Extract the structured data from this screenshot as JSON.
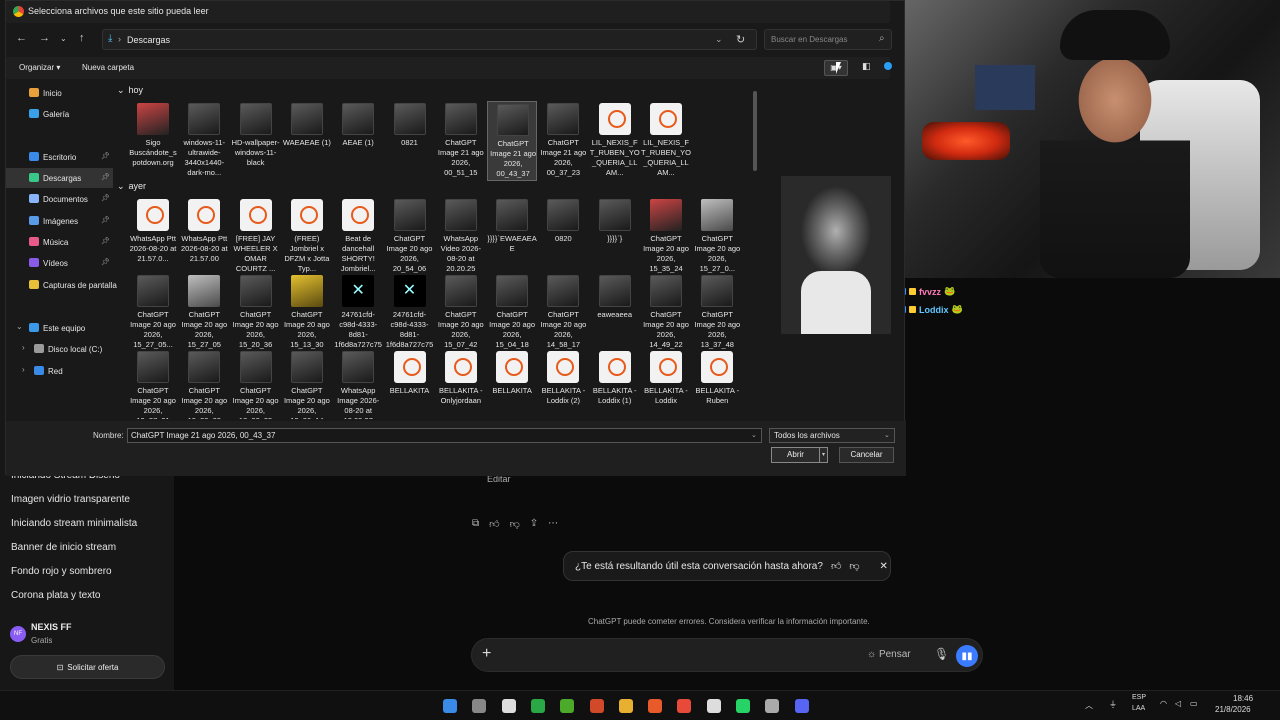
{
  "chat": {
    "history": [
      "Iniciando Stream Diseño",
      "Imagen vidrio transparente",
      "Iniciando stream minimalista",
      "Banner de inicio stream",
      "Fondo rojo y sombrero",
      "Corona plata y texto"
    ],
    "user_initials": "NF",
    "user_name": "NEXIS FF",
    "user_plan": "Gratis",
    "offer_button": "Solicitar oferta",
    "edit_label": "Editar",
    "feedback_question": "¿Te está resultando útil esta conversación hasta ahora?",
    "disclaimer": "ChatGPT puede cometer errores. Considera verificar la información importante.",
    "composer_think": "Pensar"
  },
  "stream_chat": [
    {
      "user": "fvvzz",
      "color": "#ff7ab8"
    },
    {
      "user": "Loddix",
      "color": "#5ec8ff"
    }
  ],
  "dialog": {
    "title": "Selecciona archivos que este sitio pueda leer",
    "path": "Descargas",
    "search_placeholder": "Buscar en Descargas",
    "organize": "Organizar",
    "new_folder": "Nueva carpeta",
    "nav": [
      {
        "label": "Inicio",
        "color": "#e8a03a"
      },
      {
        "label": "Galería",
        "color": "#3aa0e8"
      },
      {
        "label": "Escritorio",
        "color": "#3a8ae8",
        "pinned": true
      },
      {
        "label": "Descargas",
        "color": "#3ac88a",
        "pinned": true,
        "selected": true
      },
      {
        "label": "Documentos",
        "color": "#8ab4f8",
        "pinned": true
      },
      {
        "label": "Imágenes",
        "color": "#5a9be8",
        "pinned": true
      },
      {
        "label": "Música",
        "color": "#e85a8a",
        "pinned": true
      },
      {
        "label": "Vídeos",
        "color": "#8a5ae8",
        "pinned": true
      },
      {
        "label": "Capturas de pantalla",
        "color": "#e8c03a"
      },
      {
        "label": "Este equipo",
        "color": "#3a9ae8"
      },
      {
        "label": "Disco local (C:)",
        "color": "#9a9a9a"
      },
      {
        "label": "Red",
        "color": "#3a8ae8"
      }
    ],
    "groups": [
      "hoy",
      "ayer"
    ],
    "files_today": [
      {
        "name": "Sigo Buscándote_spotdown.org",
        "kind": "red"
      },
      {
        "name": "windows-11-ultrawide-3440x1440-dark-mo...",
        "kind": "img"
      },
      {
        "name": "HD-wallpaper-windows-11-black",
        "kind": "img"
      },
      {
        "name": "WAEAEAE (1)",
        "kind": "img"
      },
      {
        "name": "AEAE (1)",
        "kind": "img"
      },
      {
        "name": "0821",
        "kind": "img"
      },
      {
        "name": "ChatGPT Image 21 ago 2026, 00_51_15",
        "kind": "img"
      },
      {
        "name": "ChatGPT Image 21 ago 2026, 00_43_37",
        "kind": "img",
        "selected": true
      },
      {
        "name": "ChatGPT Image 21 ago 2026, 00_37_23",
        "kind": "img"
      },
      {
        "name": "LIL_NEXIS_FT_RUBEN_YO_QUERIA_LLAM...",
        "kind": "doc"
      },
      {
        "name": "LIL_NEXIS_FT_RUBEN_YO_QUERIA_LLAM...",
        "kind": "doc"
      }
    ],
    "files_yesterday": [
      {
        "name": "WhatsApp Ptt 2026-08-20 at 21.57.0...",
        "kind": "doc"
      },
      {
        "name": "WhatsApp Ptt 2026-08-20 at 21.57.00",
        "kind": "doc"
      },
      {
        "name": "[FREE] JAY WHEELER X OMAR COURTZ ...",
        "kind": "doc"
      },
      {
        "name": "(FREE) Jombriel x DFZM x Jotta Typ...",
        "kind": "doc"
      },
      {
        "name": "Beat de dancehall SHORTY! Jombriel...",
        "kind": "doc"
      },
      {
        "name": "ChatGPT Image 20 ago 2026, 20_54_06",
        "kind": "img"
      },
      {
        "name": "WhatsApp Video 2026-08-20 at 20.20.25",
        "kind": "img"
      },
      {
        "name": "}}}}`EWAEAEAE",
        "kind": "img"
      },
      {
        "name": "0820",
        "kind": "img"
      },
      {
        "name": "}}}}`}",
        "kind": "img"
      },
      {
        "name": "ChatGPT Image 20 ago 2026, 15_35_24",
        "kind": "red"
      },
      {
        "name": "ChatGPT Image 20 ago 2026, 15_27_0...",
        "kind": "img2"
      },
      {
        "name": "ChatGPT Image 20 ago 2026, 15_27_05...",
        "kind": "img"
      },
      {
        "name": "ChatGPT Image 20 ago 2026, 15_27_05",
        "kind": "img2"
      },
      {
        "name": "ChatGPT Image 20 ago 2026, 15_20_36",
        "kind": "img"
      },
      {
        "name": "ChatGPT Image 20 ago 2026, 15_13_30",
        "kind": "yel"
      },
      {
        "name": "24761cfd-c98d-4333-8d81-1f6d8a727c75-f...",
        "kind": "x"
      },
      {
        "name": "24761cfd-c98d-4333-8d81-1f6d8a727c75-f...",
        "kind": "x"
      },
      {
        "name": "ChatGPT Image 20 ago 2026, 15_07_42",
        "kind": "img"
      },
      {
        "name": "ChatGPT Image 20 ago 2026, 15_04_18",
        "kind": "img"
      },
      {
        "name": "ChatGPT Image 20 ago 2026, 14_58_17",
        "kind": "img"
      },
      {
        "name": "eaweaeea",
        "kind": "img"
      },
      {
        "name": "ChatGPT Image 20 ago 2026, 14_49_22",
        "kind": "img"
      },
      {
        "name": "ChatGPT Image 20 ago 2026, 13_37_48",
        "kind": "img"
      },
      {
        "name": "ChatGPT Image 20 ago 2026, 13_37_21",
        "kind": "img"
      },
      {
        "name": "ChatGPT Image 20 ago 2026, 13_33_33",
        "kind": "img"
      },
      {
        "name": "ChatGPT Image 20 ago 2026, 13_33_25",
        "kind": "img"
      },
      {
        "name": "ChatGPT Image 20 ago 2026, 13_26_14",
        "kind": "img"
      },
      {
        "name": "WhatsApp Image 2026-08-20 at 13.20.27",
        "kind": "img"
      },
      {
        "name": "BELLAKITA",
        "kind": "doc"
      },
      {
        "name": "BELLAKITA - Onlyjordaan",
        "kind": "doc"
      },
      {
        "name": "BELLAKITA",
        "kind": "doc"
      },
      {
        "name": "BELLAKITA - Loddix (2)",
        "kind": "doc"
      },
      {
        "name": "BELLAKITA - Loddix (1)",
        "kind": "doc"
      },
      {
        "name": "BELLAKITA - Loddix",
        "kind": "doc"
      },
      {
        "name": "BELLAKITA - Ruben",
        "kind": "doc"
      }
    ],
    "name_label": "Nombre:",
    "name_value": "ChatGPT Image 21 ago 2026, 00_43_37",
    "file_type": "Todos los archivos",
    "open_button": "Abrir",
    "cancel_button": "Cancelar"
  },
  "taskbar": {
    "apps": [
      "#3a8ae8",
      "#888",
      "#ddd",
      "#2aa845",
      "#4caa2a",
      "#d04a2a",
      "#e8b030",
      "#e85a2a",
      "#e84a3a",
      "#ddd",
      "#25d366",
      "#aaa",
      "#5865f2"
    ],
    "lang1": "ESP",
    "lang2": "LAA",
    "time": "18:46",
    "date": "21/8/2026"
  }
}
